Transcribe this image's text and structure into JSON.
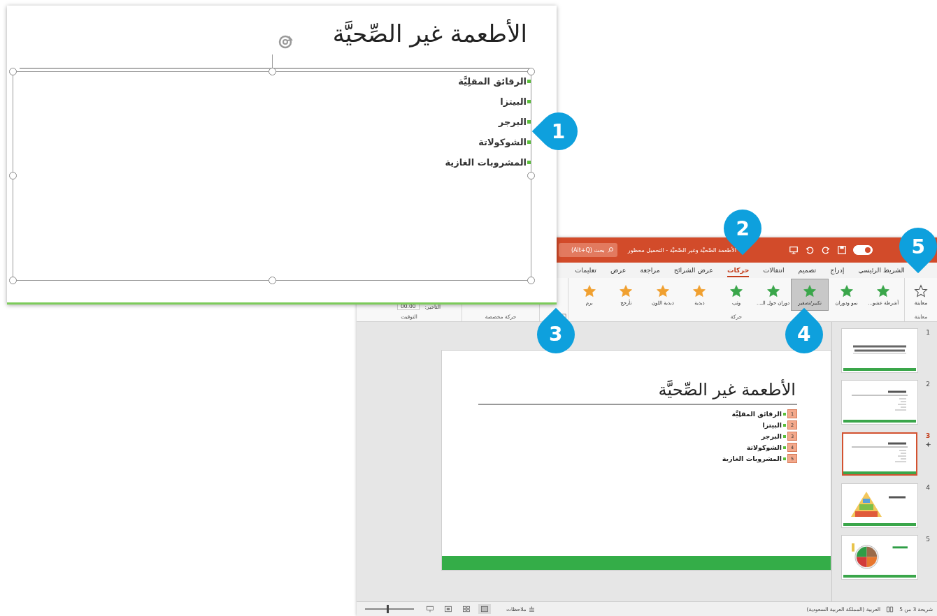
{
  "zoomed_slide": {
    "title": "الأطعمة غير الصِّحيَّة",
    "items": [
      "الرقائق المقلِيَّة",
      "البيتزا",
      "البرجر",
      "الشوكولاتة",
      "المشروبات الغازية"
    ]
  },
  "window": {
    "title": "الأطعمة الصِّحيَّة وغير الصِّحيَّة - التحميل محظور",
    "autosave_on": true,
    "search": {
      "placeholder": "بحث (Alt+Q)"
    }
  },
  "tabs": [
    {
      "label": "الشريط الرئيسي",
      "selected": false
    },
    {
      "label": "إدراج",
      "selected": false
    },
    {
      "label": "تصميم",
      "selected": false
    },
    {
      "label": "انتقالات",
      "selected": false
    },
    {
      "label": "حركات",
      "selected": true
    },
    {
      "label": "عرض الشرائح",
      "selected": false
    },
    {
      "label": "مراجعة",
      "selected": false
    },
    {
      "label": "عرض",
      "selected": false
    },
    {
      "label": "تعليمات",
      "selected": false
    }
  ],
  "ribbon": {
    "preview": {
      "label": "معاينة",
      "group": "معاينة"
    },
    "animation_group": "حركة",
    "animations": [
      {
        "label": "أشرطة عشو...",
        "color": "#3aa64a",
        "selected": false
      },
      {
        "label": "نمو ودوران",
        "color": "#3aa64a",
        "selected": false
      },
      {
        "label": "تكبير/تصغير",
        "color": "#3aa64a",
        "selected": true
      },
      {
        "label": "دوران حول الـ...",
        "color": "#3aa64a",
        "selected": false
      },
      {
        "label": "وثب",
        "color": "#3aa64a",
        "selected": false
      },
      {
        "label": "ذبذبة",
        "color": "#f0a030",
        "selected": false
      },
      {
        "label": "ذبذبة اللون",
        "color": "#f0a030",
        "selected": false
      },
      {
        "label": "تأرجح",
        "color": "#f0a030",
        "selected": false
      },
      {
        "label": "برم",
        "color": "#f0a030",
        "selected": false
      }
    ],
    "custom_group": "حركة مخصصة",
    "timing_group": "التوقيت",
    "delay": {
      "label": "التأخير:",
      "value": "00.00"
    }
  },
  "slide": {
    "title": "الأطعمة غير الصِّحيَّة",
    "items": [
      {
        "text": "الرقائق المقلِيَّة",
        "order": "1"
      },
      {
        "text": "البيتزا",
        "order": "2"
      },
      {
        "text": "البرجر",
        "order": "3"
      },
      {
        "text": "الشوكولاتة",
        "order": "4"
      },
      {
        "text": "المشروبات الغازية",
        "order": "5"
      }
    ]
  },
  "thumbnails": [
    {
      "number": "1",
      "kind": "title",
      "selected": false,
      "animated": false
    },
    {
      "number": "2",
      "kind": "list",
      "selected": false,
      "animated": false
    },
    {
      "number": "3",
      "kind": "list",
      "selected": true,
      "animated": true
    },
    {
      "number": "4",
      "kind": "pyramid",
      "selected": false,
      "animated": false
    },
    {
      "number": "5",
      "kind": "plate",
      "selected": false,
      "animated": false
    }
  ],
  "status_bar": {
    "slide_counter": "شريحة 3 من 5",
    "language": "العربية (المملكة العربية السعودية)",
    "notes": "ملاحظات",
    "zoom": {
      "level": 0.45
    }
  },
  "callouts": [
    {
      "number": "1"
    },
    {
      "number": "2"
    },
    {
      "number": "3"
    },
    {
      "number": "4"
    },
    {
      "number": "5"
    }
  ]
}
